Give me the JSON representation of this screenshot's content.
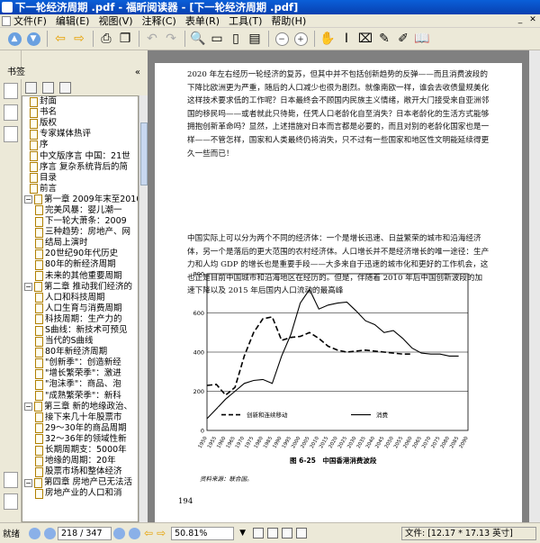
{
  "window": {
    "title": "下一轮经济周期 .pdf - 福昕阅读器 - [下一轮经济周期 .pdf]"
  },
  "menu": {
    "items": [
      "文件(F)",
      "编辑(E)",
      "视图(V)",
      "注释(C)",
      "表单(R)",
      "工具(T)",
      "帮助(H)"
    ]
  },
  "bookmarks": {
    "header": "书签",
    "items": [
      {
        "label": "封面",
        "level": 1,
        "expandable": false
      },
      {
        "label": "书名",
        "level": 1,
        "expandable": false
      },
      {
        "label": "版权",
        "level": 1,
        "expandable": false
      },
      {
        "label": "专家媒体热评",
        "level": 1,
        "expandable": false
      },
      {
        "label": "序",
        "level": 1,
        "expandable": false
      },
      {
        "label": "中文版序言 中国：21世",
        "level": 1,
        "expandable": false
      },
      {
        "label": "序言 复杂系统背后的简",
        "level": 1,
        "expandable": false
      },
      {
        "label": "目录",
        "level": 1,
        "expandable": false
      },
      {
        "label": "前言",
        "level": 1,
        "expandable": false
      },
      {
        "label": "第一章 2009年末至2010",
        "level": 0,
        "expandable": true
      },
      {
        "label": "完美风暴：婴儿潮一",
        "level": 2,
        "expandable": false
      },
      {
        "label": "下一轮大萧条：2009",
        "level": 2,
        "expandable": false
      },
      {
        "label": "三种趋势：房地产、网",
        "level": 2,
        "expandable": false
      },
      {
        "label": "结局上演时",
        "level": 2,
        "expandable": false
      },
      {
        "label": "20世纪90年代历史",
        "level": 2,
        "expandable": false
      },
      {
        "label": "80年的新经济周期",
        "level": 2,
        "expandable": false
      },
      {
        "label": "未来的其他重要周期",
        "level": 2,
        "expandable": false
      },
      {
        "label": "第二章 推动我们经济的",
        "level": 0,
        "expandable": true
      },
      {
        "label": "人口和科技周期",
        "level": 2,
        "expandable": false
      },
      {
        "label": "人口生育与消费周期",
        "level": 2,
        "expandable": false
      },
      {
        "label": "科技周期：生产力的",
        "level": 2,
        "expandable": false
      },
      {
        "label": "S曲线：新技术可预见",
        "level": 2,
        "expandable": false
      },
      {
        "label": "当代的S曲线",
        "level": 2,
        "expandable": false
      },
      {
        "label": "80年新经济周期",
        "level": 2,
        "expandable": false
      },
      {
        "label": "\"创新季\"：创造新经",
        "level": 2,
        "expandable": false
      },
      {
        "label": "\"增长繁荣季\"：激进",
        "level": 2,
        "expandable": false
      },
      {
        "label": "\"泡沫季\"：商品、泡",
        "level": 2,
        "expandable": false
      },
      {
        "label": "\"成熟繁荣季\"：新科",
        "level": 2,
        "expandable": false
      },
      {
        "label": "第三章 新的地缘政治、",
        "level": 0,
        "expandable": true
      },
      {
        "label": "接下来几十年股票市",
        "level": 2,
        "expandable": false
      },
      {
        "label": "29～30年的商品周期",
        "level": 2,
        "expandable": false
      },
      {
        "label": "32～36年的领域性新",
        "level": 2,
        "expandable": false
      },
      {
        "label": "长期周期支：5000年",
        "level": 2,
        "expandable": false
      },
      {
        "label": "地缘的周期：20年",
        "level": 2,
        "expandable": false
      },
      {
        "label": "股票市场和整体经济",
        "level": 2,
        "expandable": false
      },
      {
        "label": "第四章 房地产已无法活",
        "level": 0,
        "expandable": true
      },
      {
        "label": "房地产业的人口和消",
        "level": 2,
        "expandable": false
      }
    ]
  },
  "document": {
    "paragraph1": "2020 年左右经历一轮经济的复苏，但其中并不包括创新趋势的反弹——而且消费波段的下降比欧洲更为严重，随后的人口减少也很为剧烈。就像南欧一样，谁会去收债量规美化这样技术要求低的工作呢？日本最终会不顾国内民族主义情绪，敞开大门接受来自亚洲邻国的移民吗——或者就此只待毙，任凭人口老龄化自至消失？日本老龄化的生活方式能够拥抱创新革命吗？显然，上述措施对日本而言都是必要的，而且对别的老龄化国家也是一样——不管怎样，国家和人类最终仍将消失，只不过有一些国家和地区性文明能延续得更久一些而已！",
    "paragraph2": "中国实际上可以分为两个不同的经济体：一个是增长迅速、日益繁荣的城市和沿海经济体，另一个是落后的更大范围的农村经济体。人口增长并不是经济增长的唯一途径：生产力和人均 GDP 的增长也是重要手段——大多来自于迅速的城市化和更好的工作机会，这也正是目前中国城市和沿海地区在经历的。但是，伴随着 2010 年后中国创新波段的加速下降以及 2015 年后国内人口流动的最高峰",
    "figure_caption": "图 6-25　中国香港消费波段",
    "source_note": "资料来源：联合国。",
    "page_number": "194"
  },
  "chart_data": {
    "type": "line",
    "title": "",
    "x": [
      1950,
      1955,
      1960,
      1965,
      1970,
      1975,
      1980,
      1985,
      1990,
      1995,
      2000,
      2005,
      2010,
      2015,
      2020,
      2025,
      2030,
      2035,
      2040,
      2045,
      2050,
      2055,
      2060,
      2065,
      2070,
      2075,
      2080,
      2085,
      2090
    ],
    "xlim": [
      1950,
      2090
    ],
    "xticks": [
      1950,
      1955,
      1960,
      1965,
      1970,
      1975,
      1980,
      1985,
      1990,
      1995,
      2000,
      2005,
      2010,
      2015,
      2020,
      2025,
      2030,
      2035,
      2040,
      2045,
      2050,
      2055,
      2060,
      2065,
      2070,
      2075,
      2080,
      2085,
      2090
    ],
    "ylim": [
      0,
      800
    ],
    "yticks": [
      0,
      200,
      400,
      600,
      800
    ],
    "grid": "horizontal",
    "legend_position": "bottom-center",
    "series": [
      {
        "name": "创新和连续移动",
        "style": "dashed",
        "values": [
          230,
          235,
          180,
          220,
          380,
          500,
          570,
          580,
          460,
          475,
          480,
          500,
          470,
          430,
          410,
          400,
          405,
          410,
          405,
          400,
          395,
          390,
          390,
          null,
          null,
          null,
          null,
          null,
          null
        ]
      },
      {
        "name": "消费",
        "style": "solid",
        "values": [
          60,
          110,
          160,
          200,
          240,
          255,
          260,
          240,
          380,
          490,
          650,
          720,
          620,
          640,
          650,
          655,
          610,
          560,
          540,
          500,
          510,
          470,
          420,
          395,
          390,
          390,
          380,
          380,
          null
        ]
      }
    ]
  },
  "statusbar": {
    "ready": "就绪",
    "page_indicator": "218 / 347",
    "zoom": "50.81%",
    "file_info": "文件: [12.17 * 17.13 英寸]"
  }
}
